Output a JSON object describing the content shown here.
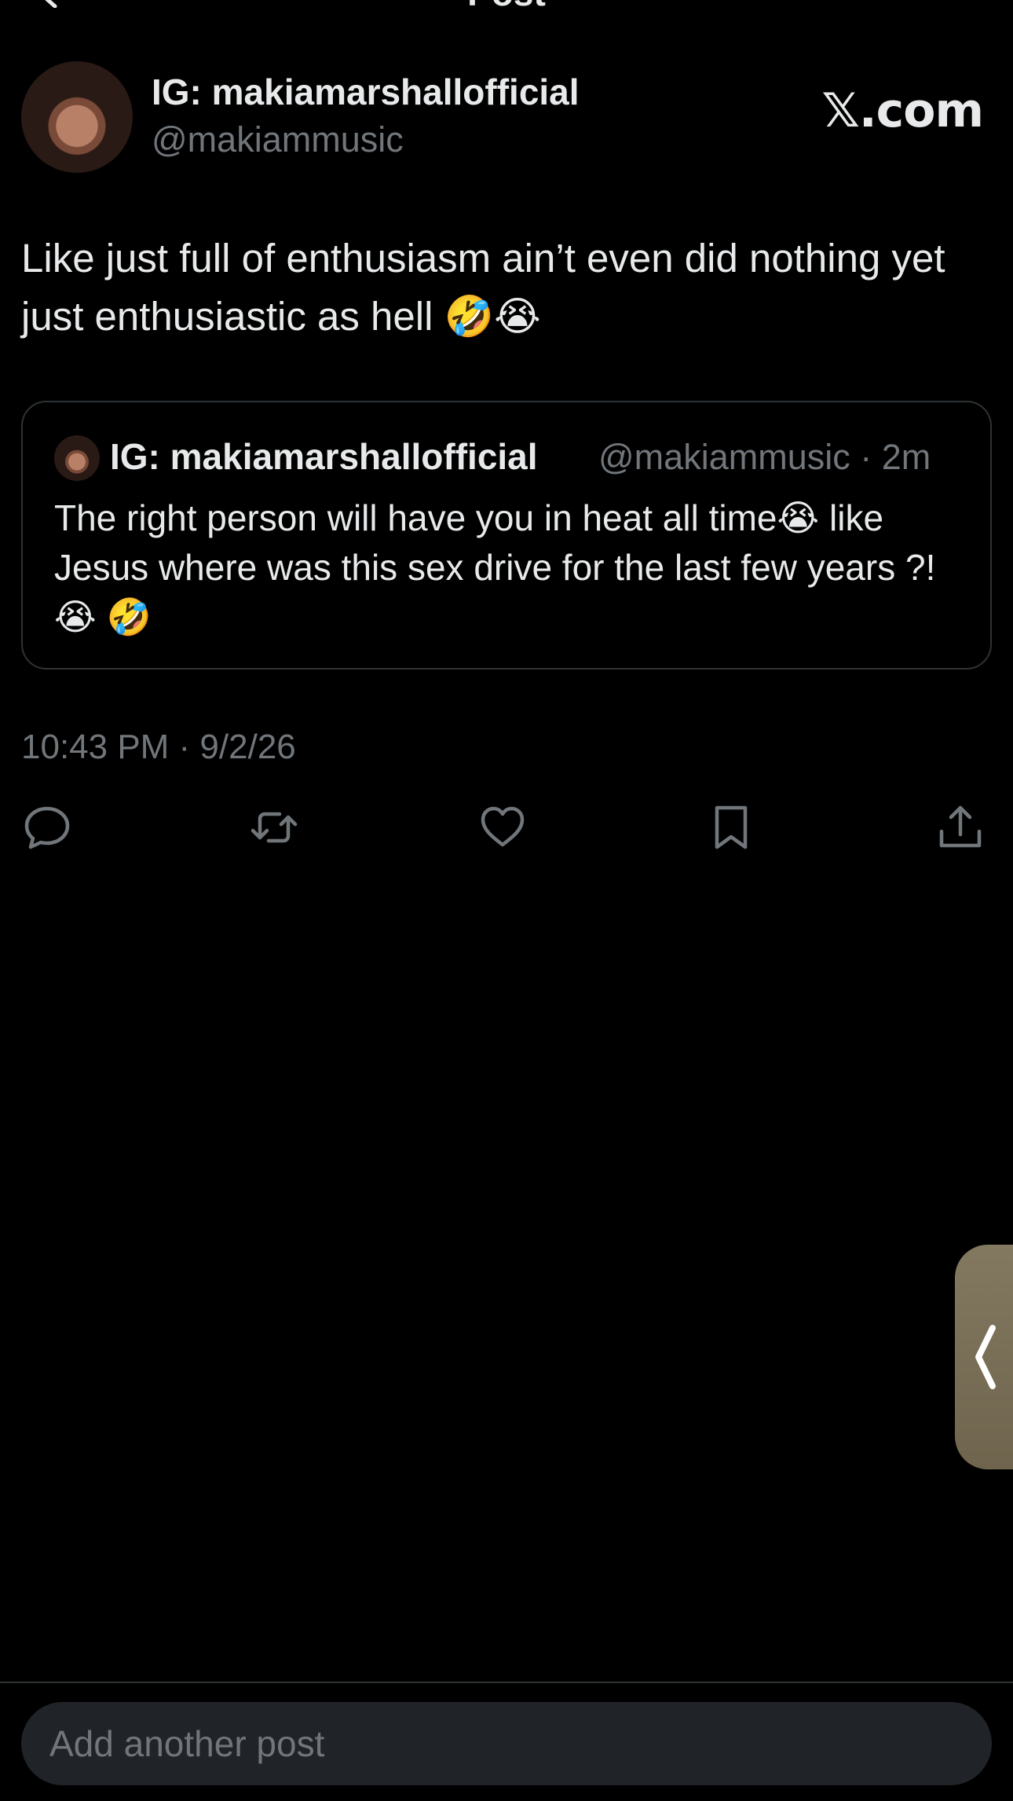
{
  "nav": {
    "title": "Post"
  },
  "author": {
    "display_name": "IG: makiamarshallofficial",
    "handle": "@makiammusic",
    "watermark": "𝕏.com"
  },
  "post": {
    "text": "Like just full of enthusiasm ain’t even did nothing yet just enthusiastic as hell 🤣😭",
    "timestamp": "10:43 PM · 9/2/26"
  },
  "quoted_post": {
    "display_name": "IG: makiamarshallofficial",
    "meta": "@makiammusic · 2m",
    "text": "The right person will have you in heat all time😭 like Jesus where was this sex drive for the last few years ?!😭 🤣"
  },
  "actions": {
    "reply_icon": "speech-bubble-icon",
    "repost_icon": "repost-arrows-icon",
    "like_icon": "heart-icon",
    "bookmark_icon": "bookmark-icon",
    "share_icon": "share-upload-icon"
  },
  "composer": {
    "placeholder": "Add another post"
  },
  "colors": {
    "background": "#000000",
    "primary_text": "#e7e9ea",
    "secondary_text": "#71767b",
    "border": "#2f3336",
    "input_bg": "#202327",
    "edge_handle": "#7a6f57"
  }
}
